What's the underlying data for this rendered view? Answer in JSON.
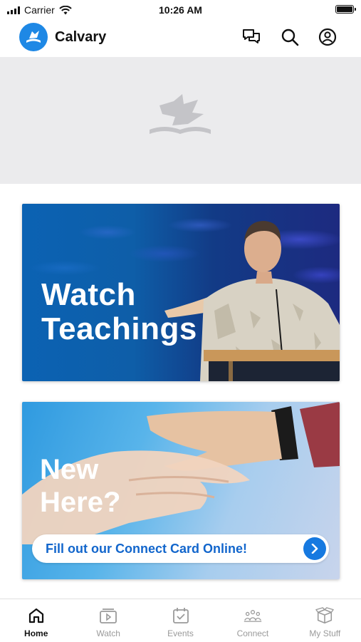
{
  "status_bar": {
    "carrier": "Carrier",
    "time": "10:26 AM"
  },
  "header": {
    "brand": "Calvary",
    "icons": [
      "chat-icon",
      "search-icon",
      "account-icon"
    ]
  },
  "hero": {
    "placeholder_icon": "dove-bible-icon"
  },
  "cards": [
    {
      "title_line1": "Watch",
      "title_line2": "Teachings"
    },
    {
      "title_line1": "New",
      "title_line2": "Here?",
      "cta_label": "Fill out our Connect Card Online!"
    }
  ],
  "tabs": [
    {
      "label": "Home",
      "icon": "home-icon",
      "active": true
    },
    {
      "label": "Watch",
      "icon": "video-icon",
      "active": false
    },
    {
      "label": "Events",
      "icon": "calendar-icon",
      "active": false
    },
    {
      "label": "Connect",
      "icon": "group-icon",
      "active": false
    },
    {
      "label": "My Stuff",
      "icon": "box-icon",
      "active": false
    }
  ],
  "colors": {
    "brand_blue": "#1e88e5",
    "cta_text": "#1266cc",
    "cta_button": "#1679e0"
  }
}
